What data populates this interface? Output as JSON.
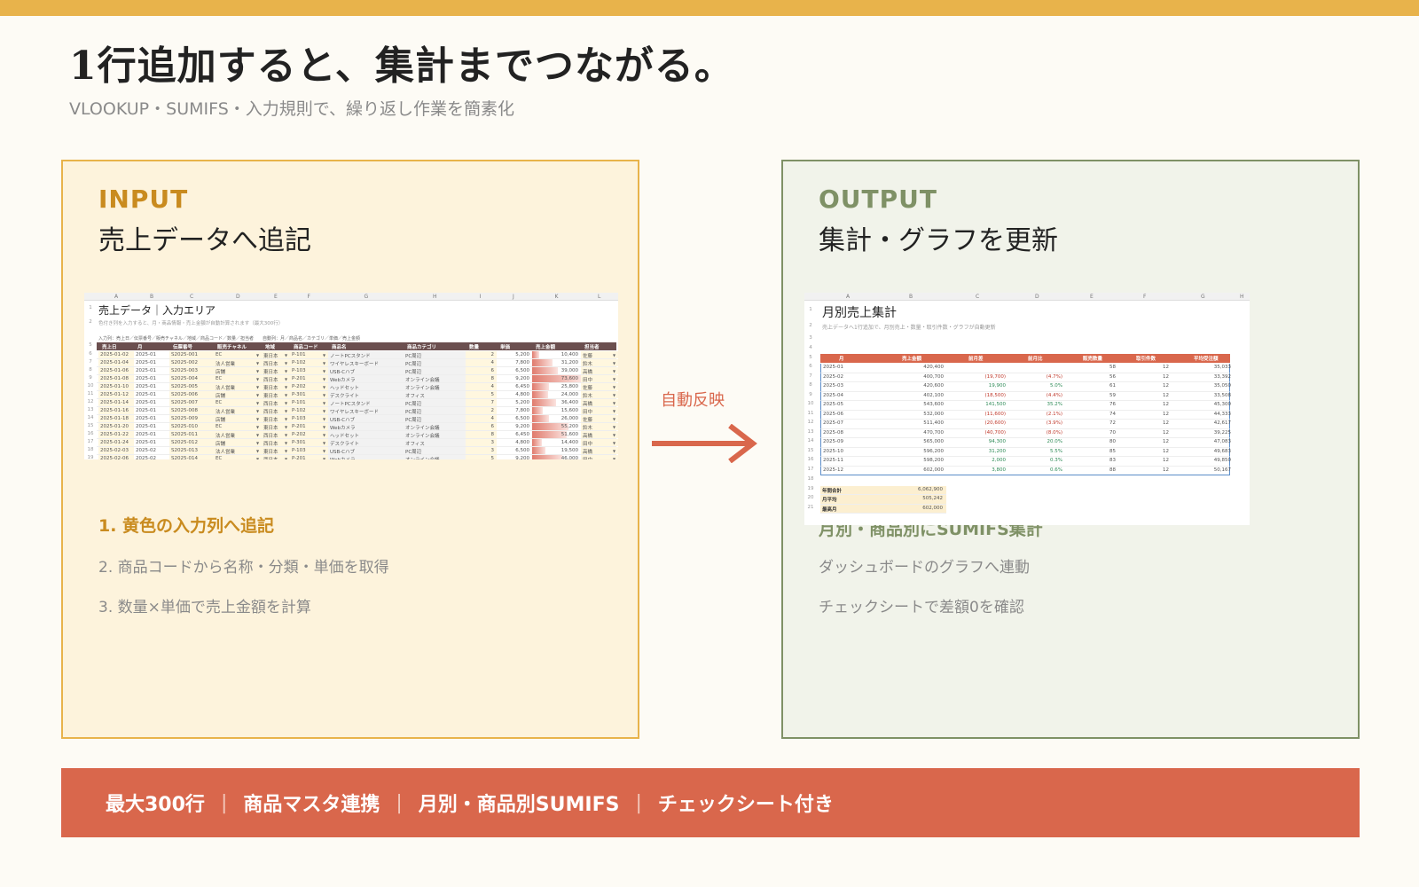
{
  "title": "1行追加すると、集計までつながる。",
  "subtitle": "VLOOKUP・SUMIFS・入力規則で、繰り返し作業を簡素化",
  "input_panel": {
    "tag": "INPUT",
    "heading": "売上データへ追記",
    "steps": [
      "1. 黄色の入力列へ追記",
      "2. 商品コードから名称・分類・単価を取得",
      "3. 数量×単価で売上金額を計算"
    ]
  },
  "output_panel": {
    "tag": "OUTPUT",
    "heading": "集計・グラフを更新",
    "steps": [
      "月別・商品別にSUMIFS集計",
      "ダッシュボードのグラフへ連動",
      "チェックシートで差額0を確認"
    ]
  },
  "arrow_label": "自動反映",
  "features": [
    "最大300行",
    "商品マスタ連携",
    "月別・商品別SUMIFS",
    "チェックシート付き"
  ],
  "input_sheet": {
    "col_letters": [
      "A",
      "B",
      "C",
      "D",
      "E",
      "F",
      "G",
      "H",
      "I",
      "J",
      "K",
      "L"
    ],
    "title": "売上データ｜入力エリア",
    "note": "色付き列を入力すると、月・商品情報・売上金額が自動計算されます（最大300行）",
    "legend": "入力列：売上日／伝票番号／販売チャネル／地域／商品コード／数量／担当者　　自動列：月／商品名／カテゴリ／単価／売上金額",
    "headers": [
      "売上日",
      "月",
      "伝票番号",
      "販売チャネル",
      "地域",
      "商品コード",
      "商品名",
      "商品カテゴリ",
      "数量",
      "単価",
      "売上金額",
      "担当者"
    ],
    "rows": [
      [
        "2025-01-02",
        "2025-01",
        "S2025-001",
        "EC",
        "東日本",
        "P-101",
        "ノートPCスタンド",
        "PC周辺",
        "2",
        "5,200",
        "10,400",
        "佐藤"
      ],
      [
        "2025-01-04",
        "2025-01",
        "S2025-002",
        "法人営業",
        "西日本",
        "P-102",
        "ワイヤレスキーボード",
        "PC周辺",
        "4",
        "7,800",
        "31,200",
        "鈴木"
      ],
      [
        "2025-01-06",
        "2025-01",
        "S2025-003",
        "店舗",
        "東日本",
        "P-103",
        "USB-Cハブ",
        "PC周辺",
        "6",
        "6,500",
        "39,000",
        "高橋"
      ],
      [
        "2025-01-08",
        "2025-01",
        "S2025-004",
        "EC",
        "西日本",
        "P-201",
        "Webカメラ",
        "オンライン会議",
        "8",
        "9,200",
        "73,600",
        "田中"
      ],
      [
        "2025-01-10",
        "2025-01",
        "S2025-005",
        "法人営業",
        "東日本",
        "P-202",
        "ヘッドセット",
        "オンライン会議",
        "4",
        "6,450",
        "25,800",
        "佐藤"
      ],
      [
        "2025-01-12",
        "2025-01",
        "S2025-006",
        "店舗",
        "東日本",
        "P-301",
        "デスクライト",
        "オフィス",
        "5",
        "4,800",
        "24,000",
        "鈴木"
      ],
      [
        "2025-01-14",
        "2025-01",
        "S2025-007",
        "EC",
        "西日本",
        "P-101",
        "ノートPCスタンド",
        "PC周辺",
        "7",
        "5,200",
        "36,400",
        "高橋"
      ],
      [
        "2025-01-16",
        "2025-01",
        "S2025-008",
        "法人営業",
        "西日本",
        "P-102",
        "ワイヤレスキーボード",
        "PC周辺",
        "2",
        "7,800",
        "15,600",
        "田中"
      ],
      [
        "2025-01-18",
        "2025-01",
        "S2025-009",
        "店舗",
        "東日本",
        "P-103",
        "USB-Cハブ",
        "PC周辺",
        "4",
        "6,500",
        "26,000",
        "佐藤"
      ],
      [
        "2025-01-20",
        "2025-01",
        "S2025-010",
        "EC",
        "東日本",
        "P-201",
        "Webカメラ",
        "オンライン会議",
        "6",
        "9,200",
        "55,200",
        "鈴木"
      ],
      [
        "2025-01-22",
        "2025-01",
        "S2025-011",
        "法人営業",
        "西日本",
        "P-202",
        "ヘッドセット",
        "オンライン会議",
        "8",
        "6,450",
        "51,600",
        "高橋"
      ],
      [
        "2025-01-24",
        "2025-01",
        "S2025-012",
        "店舗",
        "西日本",
        "P-301",
        "デスクライト",
        "オフィス",
        "3",
        "4,800",
        "14,400",
        "田中"
      ],
      [
        "2025-02-03",
        "2025-02",
        "S2025-013",
        "法人営業",
        "東日本",
        "P-103",
        "USB-Cハブ",
        "PC周辺",
        "3",
        "6,500",
        "19,500",
        "高橋"
      ],
      [
        "2025-02-06",
        "2025-02",
        "S2025-014",
        "EC",
        "西日本",
        "P-201",
        "Webカメラ",
        "オンライン会議",
        "5",
        "9,200",
        "46,000",
        "田中"
      ],
      [
        "2025-02-07",
        "2025-02",
        "S2025-015",
        "EC",
        "西日本",
        "P-202",
        "ヘッドセット",
        "PC周辺",
        "7",
        "8,600",
        "60,200",
        "佐藤"
      ]
    ]
  },
  "output_sheet": {
    "col_letters": [
      "A",
      "B",
      "C",
      "D",
      "E",
      "F",
      "G",
      "H"
    ],
    "title": "月別売上集計",
    "note": "売上データへ1行追加で、月別売上・数量・取引件数・グラフが自動更新",
    "headers": [
      "月",
      "売上金額",
      "前月差",
      "前月比",
      "販売数量",
      "取引件数",
      "平均受注額"
    ],
    "rows": [
      [
        "2025-01",
        "420,400",
        "",
        "",
        "58",
        "12",
        "35,033"
      ],
      [
        "2025-02",
        "400,700",
        "(19,700)",
        "(4.7%)",
        "56",
        "12",
        "33,392"
      ],
      [
        "2025-03",
        "420,600",
        "19,900",
        "5.0%",
        "61",
        "12",
        "35,050"
      ],
      [
        "2025-04",
        "402,100",
        "(18,500)",
        "(4.4%)",
        "59",
        "12",
        "33,508"
      ],
      [
        "2025-05",
        "543,600",
        "141,500",
        "35.2%",
        "76",
        "12",
        "45,300"
      ],
      [
        "2025-06",
        "532,000",
        "(11,600)",
        "(2.1%)",
        "74",
        "12",
        "44,333"
      ],
      [
        "2025-07",
        "511,400",
        "(20,600)",
        "(3.9%)",
        "72",
        "12",
        "42,617"
      ],
      [
        "2025-08",
        "470,700",
        "(40,700)",
        "(8.0%)",
        "70",
        "12",
        "39,225"
      ],
      [
        "2025-09",
        "565,000",
        "94,300",
        "20.0%",
        "80",
        "12",
        "47,083"
      ],
      [
        "2025-10",
        "596,200",
        "31,200",
        "5.5%",
        "85",
        "12",
        "49,683"
      ],
      [
        "2025-11",
        "598,200",
        "2,000",
        "0.3%",
        "83",
        "12",
        "49,850"
      ],
      [
        "2025-12",
        "602,000",
        "3,800",
        "0.6%",
        "88",
        "12",
        "50,167"
      ]
    ],
    "summary": [
      [
        "年間合計",
        "6,062,900"
      ],
      [
        "月平均",
        "505,242"
      ],
      [
        "最高月",
        "602,000"
      ]
    ]
  },
  "colors": {
    "accent_gold": "#e8b34b",
    "accent_green": "#7f9166",
    "accent_orange": "#d9674c",
    "input_header": "#6b4f4f",
    "output_header": "#d9674c"
  }
}
